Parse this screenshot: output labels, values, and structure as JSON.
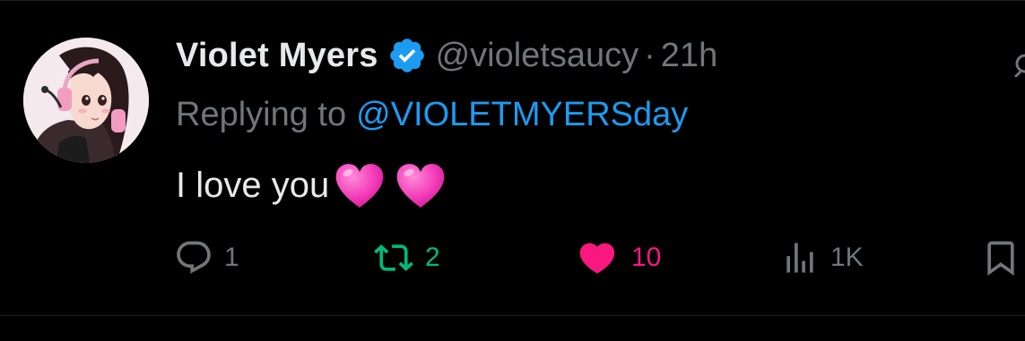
{
  "tweet": {
    "author": {
      "display_name": "Violet Myers",
      "handle": "@violetsaucy",
      "verified": true,
      "avatar_icon": "anime-girl-headset-avatar"
    },
    "separator": "·",
    "timestamp": "21h",
    "reply": {
      "label": "Replying to",
      "mention": "@VIOLETMYERSday"
    },
    "text": "I love you",
    "emojis": [
      "pink-heart-emoji",
      "pink-heart-emoji"
    ],
    "actions": {
      "reply": {
        "icon": "reply-bubble-icon",
        "count": "1"
      },
      "retweet": {
        "icon": "retweet-icon",
        "count": "2"
      },
      "like": {
        "icon": "heart-icon",
        "count": "10",
        "active": true
      },
      "views": {
        "icon": "views-bar-chart-icon",
        "count": "1K"
      },
      "bookmark": {
        "icon": "bookmark-icon"
      }
    }
  },
  "colors": {
    "background": "#000000",
    "primary_text": "#e7e9ea",
    "secondary_text": "#71767b",
    "link": "#1d9bf0",
    "verified": "#1d9bf0",
    "retweet": "#00ba7c",
    "like": "#f91880"
  }
}
